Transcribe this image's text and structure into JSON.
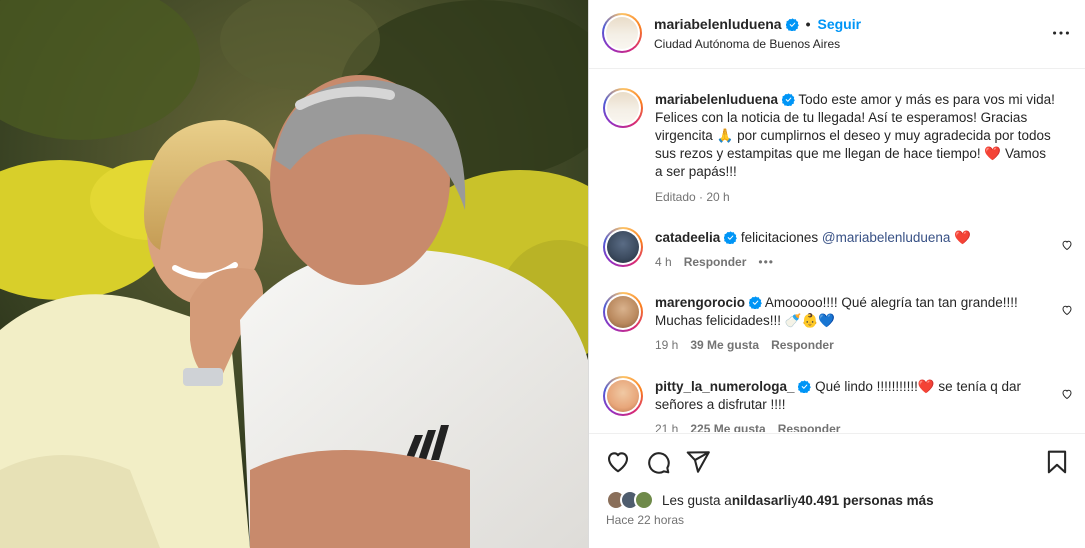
{
  "post": {
    "username": "mariabelenluduena",
    "follow_label": "Seguir",
    "location": "Ciudad Autónoma de Buenos Aires",
    "caption": "Todo este amor y más es para vos mi vida! Felices con la noticia de tu llegada! Así te esperamos! Gracias virgencita 🙏 por cumplirnos el deseo y muy agradecida por todos sus rezos y estampitas que me llegan de hace tiempo! ❤️ Vamos a ser papás!!!",
    "caption_meta": "Editado · 20 h"
  },
  "comments": [
    {
      "username": "catadeelia",
      "text_before": "felicitaciones ",
      "mention": "@mariabelenluduena",
      "text_after": " ❤️",
      "time": "4 h",
      "likes": "",
      "reply_label": "Responder",
      "more": "•••"
    },
    {
      "username": "marengorocio",
      "text_before": "Amooooo!!!! Qué alegría tan tan grande!!!! Muchas felicidades!!! 🍼👶💙",
      "mention": "",
      "text_after": "",
      "time": "19 h",
      "likes": "39 Me gusta",
      "reply_label": "Responder",
      "more": ""
    },
    {
      "username": "pitty_la_numerologa_",
      "text_before": "Qué lindo !!!!!!!!!!!❤️ se tenía q dar señores a disfrutar !!!!",
      "mention": "",
      "text_after": "",
      "time": "21 h",
      "likes": "225 Me gusta",
      "reply_label": "Responder",
      "more": ""
    }
  ],
  "footer": {
    "likes_prefix": "Les gusta a ",
    "liked_by": "nildasarli",
    "likes_mid": " y ",
    "likes_count": "40.491 personas más",
    "timestamp": "Hace 22 horas"
  },
  "icons": {
    "verified": "verified-badge-icon",
    "more": "more-options-icon",
    "like": "heart-icon",
    "comment": "comment-bubble-icon",
    "share": "paper-plane-icon",
    "save": "bookmark-icon"
  },
  "colors": {
    "accent": "#0095f6",
    "text": "#262626",
    "secondary": "#737373",
    "verified": "#0095f6",
    "heart": "#ed4956"
  }
}
